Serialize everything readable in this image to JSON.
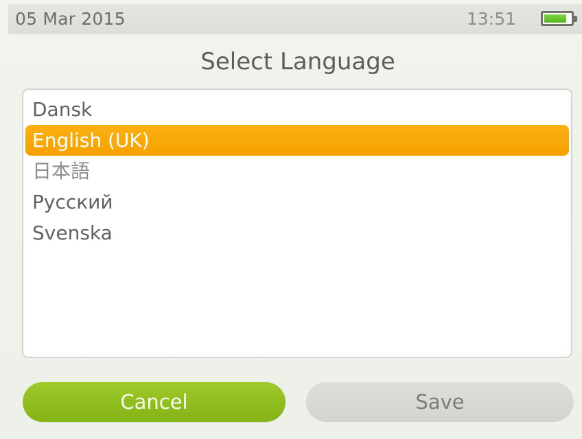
{
  "status_bar": {
    "date": "05 Mar 2015",
    "time": "13:51",
    "battery_icon": "battery-icon",
    "battery_level": 0.85,
    "battery_color": "#5ec428"
  },
  "dialog": {
    "title": "Select Language",
    "languages": [
      {
        "label": "Dansk",
        "selected": false
      },
      {
        "label": "English (UK)",
        "selected": true
      },
      {
        "label": "日本語",
        "selected": false
      },
      {
        "label": "Русский",
        "selected": false
      },
      {
        "label": "Svenska",
        "selected": false
      }
    ],
    "selection_color": "#f6a200",
    "cancel_label": "Cancel",
    "save_label": "Save",
    "cancel_color": "#8cba1c"
  }
}
